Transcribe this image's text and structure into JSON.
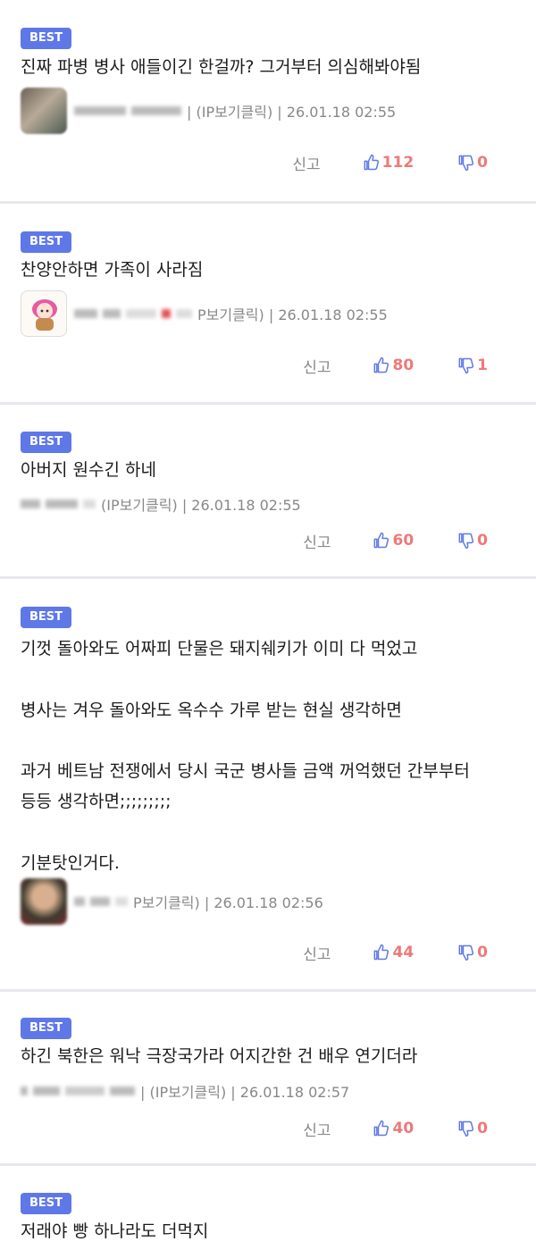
{
  "badge_label": "BEST",
  "report_label": "신고",
  "comments": [
    {
      "text": "진짜 파병 병사 애들이긴 한걸까? 그거부터 의심해봐야됨",
      "info": "| (IP보기클릭) | 26.01.18 02:55",
      "likes": "112",
      "dislikes": "0"
    },
    {
      "text": "찬양안하면 가족이 사라짐",
      "info": "P보기클릭) | 26.01.18 02:55",
      "likes": "80",
      "dislikes": "1"
    },
    {
      "text": "아버지 원수긴 하네",
      "info": "(IP보기클릭) | 26.01.18 02:55",
      "likes": "60",
      "dislikes": "0"
    },
    {
      "text": "기껏 돌아와도 어짜피 단물은 돼지쉐키가 이미 다 먹었고\n\n병사는 겨우 돌아와도 옥수수 가루 받는 현실 생각하면\n\n과거 베트남 전쟁에서 당시 국군 병사들 금액 꺼억했던 간부부터\n등등 생각하면;;;;;;;;;\n\n기분탓인거다.",
      "info": "P보기클릭) | 26.01.18 02:56",
      "likes": "44",
      "dislikes": "0"
    },
    {
      "text": "하긴 북한은 워낙 극장국가라 어지간한 건 배우 연기더라",
      "info": "| (IP보기클릭) | 26.01.18 02:57",
      "likes": "40",
      "dislikes": "0"
    },
    {
      "text": "저래야 빵 하나라도 더먹지"
    }
  ]
}
